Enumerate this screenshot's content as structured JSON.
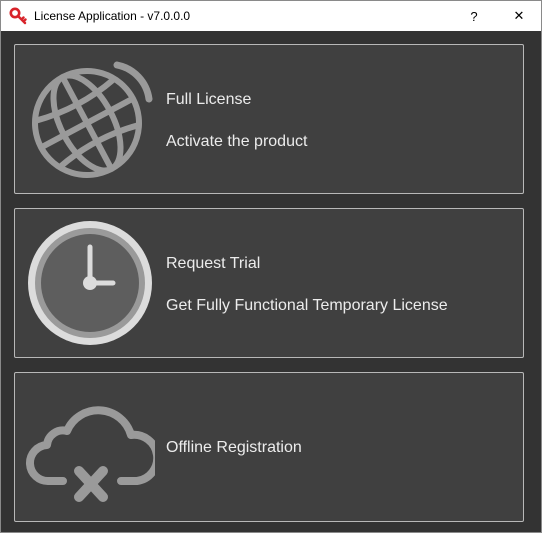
{
  "window": {
    "title": "License Application - v7.0.0.0",
    "help_label": "?",
    "close_label": "✕"
  },
  "options": [
    {
      "icon": "globe-icon",
      "title": "Full License",
      "subtitle": "Activate the product"
    },
    {
      "icon": "clock-icon",
      "title": "Request Trial",
      "subtitle": "Get Fully Functional Temporary License"
    },
    {
      "icon": "cloud-offline-icon",
      "title": "Offline Registration"
    }
  ],
  "colors": {
    "background": "#333333",
    "panel": "#404040",
    "panel_border": "#b8b8b8",
    "icon_gray": "#9a9a9a",
    "text": "#ececec",
    "app_icon_red": "#d8232a"
  }
}
